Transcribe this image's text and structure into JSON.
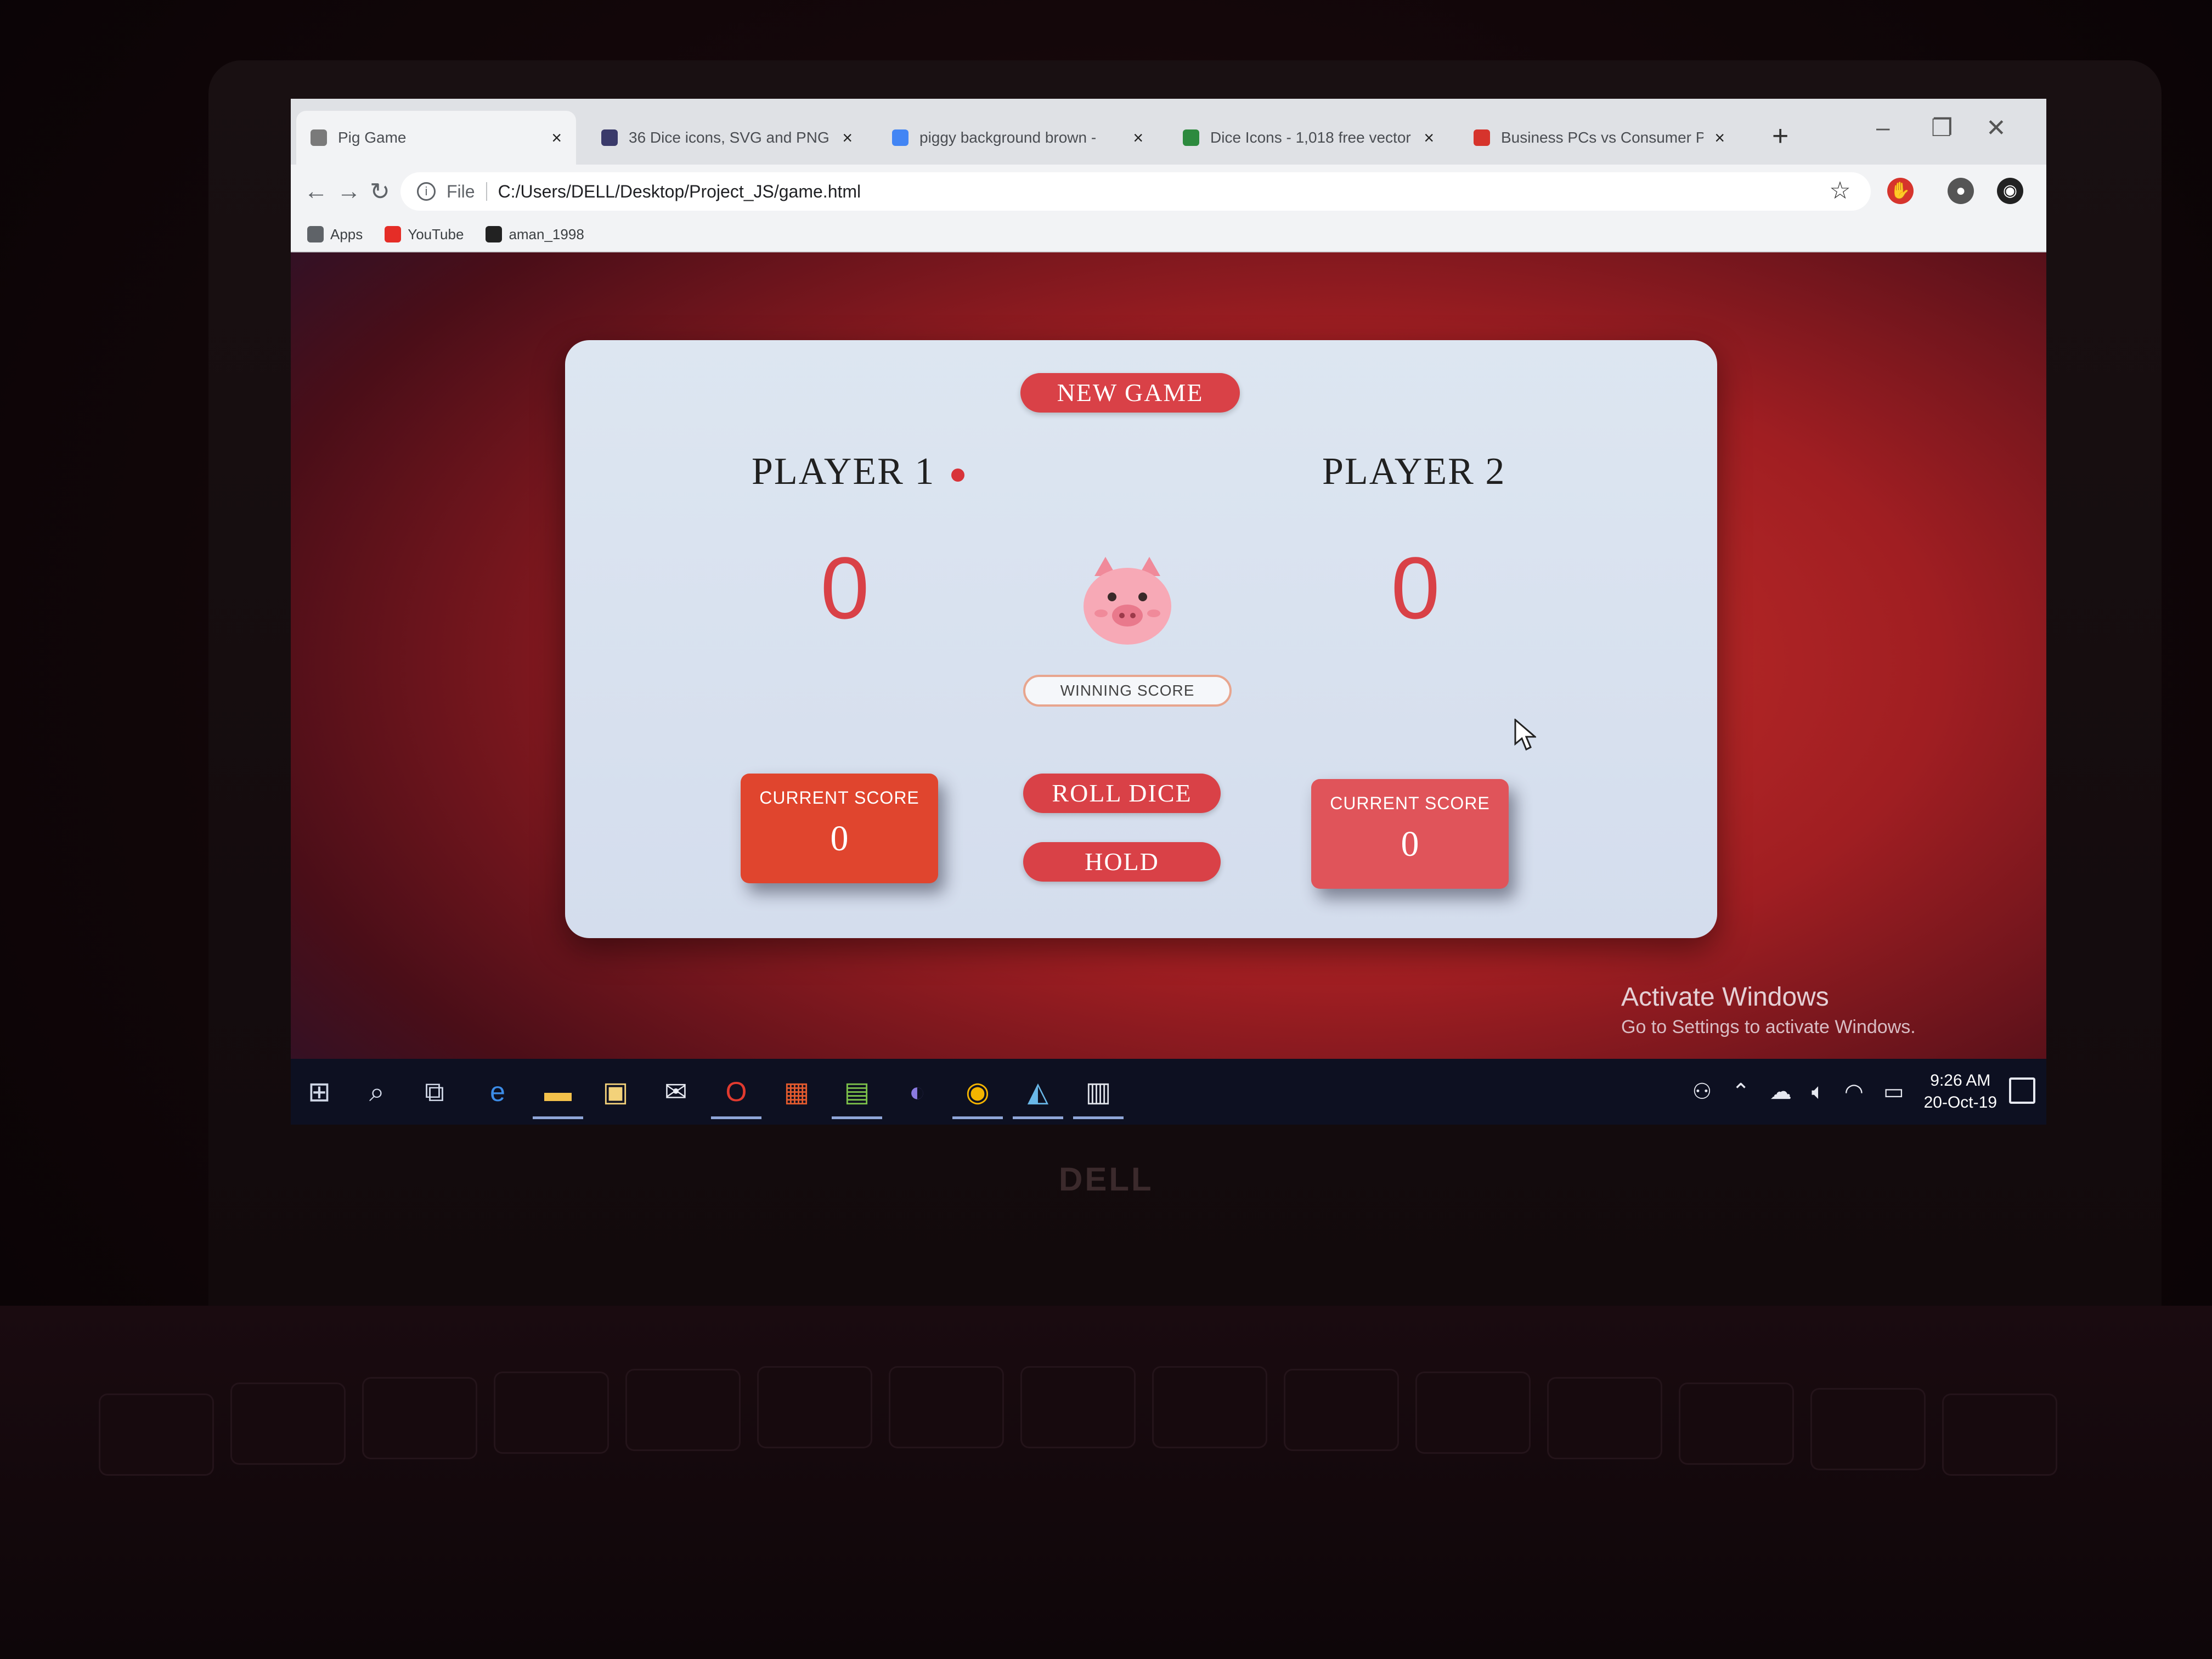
{
  "browser": {
    "tabs": [
      {
        "title": "Pig Game",
        "active": true,
        "favicon_color": "#7a7a7a"
      },
      {
        "title": "36 Dice icons, SVG and PNG |",
        "active": false,
        "favicon_color": "#3a3a6a"
      },
      {
        "title": "piggy background brown -",
        "active": false,
        "favicon_color": "#4285f4"
      },
      {
        "title": "Dice Icons - 1,018 free vector",
        "active": false,
        "favicon_color": "#2d8a3e"
      },
      {
        "title": "Business PCs vs Consumer PC:",
        "active": false,
        "favicon_color": "#d6342c"
      }
    ],
    "tab_close": "×",
    "new_tab": "+",
    "url_scheme": "File",
    "url": "C:/Users/DELL/Desktop/Project_JS/game.html",
    "bookmarks": [
      {
        "label": "Apps",
        "icon": "apps-grid-icon",
        "color": "#5f6368"
      },
      {
        "label": "YouTube",
        "icon": "youtube-icon",
        "color": "#e52d27"
      },
      {
        "label": "aman_1998",
        "icon": "github-icon",
        "color": "#222222"
      }
    ]
  },
  "game": {
    "new_game_label": "NEW GAME",
    "player1": {
      "name": "PLAYER 1",
      "total": "0",
      "current_label": "CURRENT SCORE",
      "current": "0",
      "active": true
    },
    "player2": {
      "name": "PLAYER 2",
      "total": "0",
      "current_label": "CURRENT SCORE",
      "current": "0",
      "active": false
    },
    "winning_score_placeholder": "WINNING SCORE",
    "roll_dice_label": "ROLL DICE",
    "hold_label": "HOLD",
    "colors": {
      "accent": "#d94147",
      "active_box": "#e0452e",
      "inactive_box": "#e0545a",
      "card": "#dde6f1"
    }
  },
  "watermark": {
    "title": "Activate Windows",
    "subtitle": "Go to Settings to activate Windows."
  },
  "taskbar": {
    "apps": [
      {
        "name": "start-icon",
        "glyph": "⊞"
      },
      {
        "name": "search-icon",
        "glyph": "⌕"
      },
      {
        "name": "task-view-icon",
        "glyph": "⧉"
      },
      {
        "name": "edge-icon",
        "glyph": "e"
      },
      {
        "name": "file-explorer-icon",
        "glyph": "▬"
      },
      {
        "name": "store-icon",
        "glyph": "▣"
      },
      {
        "name": "mail-icon",
        "glyph": "✉"
      },
      {
        "name": "opera-icon",
        "glyph": "O"
      },
      {
        "name": "office-icon",
        "glyph": "▦"
      },
      {
        "name": "notepad-icon",
        "glyph": "▤"
      },
      {
        "name": "eclipse-icon",
        "glyph": "◐"
      },
      {
        "name": "chrome-icon",
        "glyph": "◉"
      },
      {
        "name": "paint-icon",
        "glyph": "◭"
      },
      {
        "name": "calculator-icon",
        "glyph": "▥"
      }
    ],
    "time": "9:26 AM",
    "date": "20-Oct-19"
  }
}
